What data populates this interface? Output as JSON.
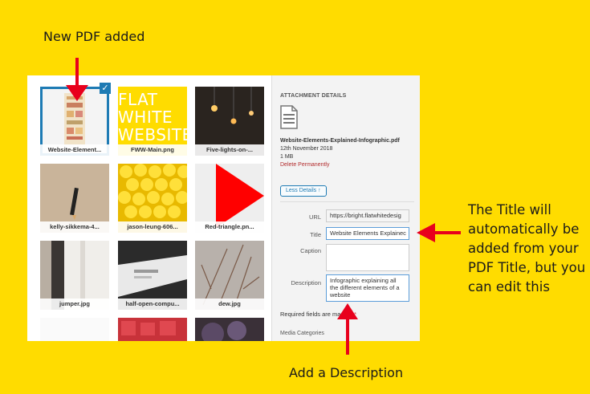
{
  "annotations": {
    "new_pdf": "New PDF added",
    "title_note": "The Title will automatically be added from your PDF Title, but you can edit this",
    "description_note": "Add a Description"
  },
  "media_grid": {
    "items": [
      {
        "label": "Website-Element...",
        "selected": true
      },
      {
        "label": "FWW-Main.png",
        "selected": false,
        "image_text": "FLAT WHITE WEBSITES"
      },
      {
        "label": "Five-lights-on-...",
        "selected": false
      },
      {
        "label": "kelly-sikkema-4...",
        "selected": false
      },
      {
        "label": "jason-leung-606...",
        "selected": false
      },
      {
        "label": "Red-triangle.pn...",
        "selected": false
      },
      {
        "label": "jumper.jpg",
        "selected": false
      },
      {
        "label": "half-open-compu...",
        "selected": false
      },
      {
        "label": "dew.jpg",
        "selected": false
      }
    ]
  },
  "details": {
    "section_title": "ATTACHMENT DETAILS",
    "file_icon": "document-icon",
    "filename": "Website-Elements-Explained-Infographic.pdf",
    "date": "12th November 2018",
    "size": "1 MB",
    "delete_link": "Delete Permanently",
    "less_details": "Less Details ↑",
    "url_label": "URL",
    "url_value": "https://bright.flatwhitedesig",
    "title_label": "Title",
    "title_value": "Website Elements Explainec",
    "caption_label": "Caption",
    "caption_value": "",
    "description_label": "Description",
    "description_value": "Infographic explaining all the different elements of a website",
    "required_text": "Required fields are marked",
    "required_star": "*",
    "media_categories": "Media Categories"
  },
  "colors": {
    "background": "#ffdc00",
    "arrow": "#e8001c",
    "selection": "#1e7bb4",
    "delete": "#b32d2e"
  }
}
